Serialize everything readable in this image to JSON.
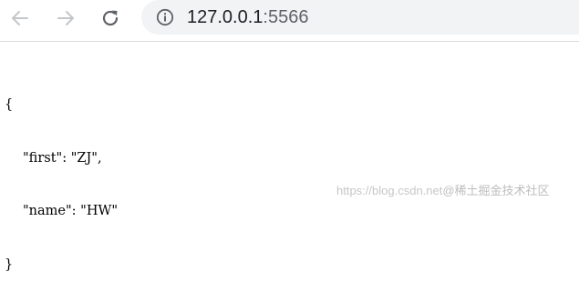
{
  "toolbar": {
    "back_icon": "arrow-left-icon",
    "forward_icon": "arrow-right-icon",
    "reload_icon": "reload-icon",
    "info_icon": "info-circle-icon",
    "url_host": "127.0.0.1",
    "url_port": ":5566"
  },
  "json_view": {
    "open_brace": "{",
    "line1_key": "\"first\"",
    "line1_sep": ": ",
    "line1_value": "\"ZJ\"",
    "line1_comma": ",",
    "line2_key": "\"name\"",
    "line2_sep": ": ",
    "line2_value": "\"HW\"",
    "close_brace": "}"
  },
  "watermark": {
    "url": "https://blog.csdn.net",
    "brand": "@稀土掘金技术社区"
  },
  "colors": {
    "icon_disabled": "#c4c7ca",
    "icon_active": "#5f6368",
    "omnibox_bg": "#f1f3f4",
    "divider": "#dadce0"
  }
}
